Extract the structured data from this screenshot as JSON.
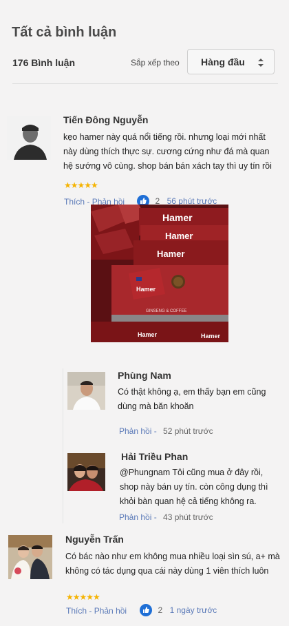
{
  "header": {
    "title": "Tất cả bình luận",
    "count_label": "176 Bình luận",
    "sort_label": "Sắp xếp theo",
    "sort_value": "Hàng đầu"
  },
  "comments": [
    {
      "name": "Tiến Đông Nguyễn",
      "text": "kẹo hamer này quá nổi tiếng rồi. nhưng loại mới nhất này dùng thích thực sự. cương cứng như đá mà quan hệ sướng vô cùng. shop bán bán xách tay thì uy tín rồi",
      "rating": 5,
      "stars": "★★★★★",
      "like_label": "Thích",
      "reply_label": "Phản hồi",
      "likes": "2",
      "time": "56 phút trước",
      "image": {
        "brand": "Hamer",
        "subtitle": "GINSENG & COFFEE"
      },
      "replies": [
        {
          "name": "Phùng Nam",
          "text": "Có thật không ạ, em thấy bạn em cũng dùng mà băn khoăn",
          "reply_label": "Phản hồi -",
          "time": "52 phút trước"
        },
        {
          "name": "Hải Triều Phan",
          "text": "@Phungnam Tôi cũng mua ở đây rồi, shop này bán uy tín. còn công dụng thì khỏi bàn quan hệ cả tiếng không ra.",
          "reply_label": "Phản hồi -",
          "time": "43 phút trước"
        }
      ]
    },
    {
      "name": "Nguyễn Trấn",
      "text": "Có bác nào như em không mua nhiều loại sìn sú, a+ mà không có tác dụng qua cái này dùng 1 viên thích luôn",
      "rating": 5,
      "stars": "★★★★★",
      "like_label": "Thích",
      "reply_label": "Phản hồi",
      "likes": "2",
      "time": "1 ngày trước"
    }
  ],
  "colors": {
    "link": "#5b7ab8",
    "star": "#f5b301",
    "like": "#1f6fd6",
    "product_red": "#8e1b1f"
  }
}
